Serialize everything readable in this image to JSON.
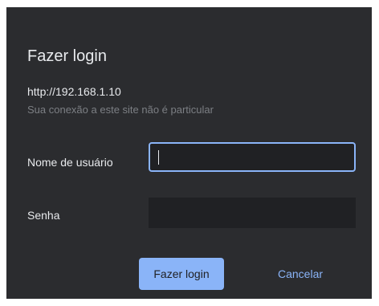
{
  "dialog": {
    "title": "Fazer login",
    "url": "http://192.168.1.10",
    "warning": "Sua conexão a este site não é particular"
  },
  "fields": {
    "username": {
      "label": "Nome de usuário",
      "value": ""
    },
    "password": {
      "label": "Senha",
      "value": ""
    }
  },
  "buttons": {
    "login": "Fazer login",
    "cancel": "Cancelar"
  },
  "colors": {
    "dialog_bg": "#2b2c2f",
    "input_bg": "#202124",
    "accent": "#8ab4f8",
    "text": "#e8eaed",
    "muted_text": "#7c7f84"
  }
}
